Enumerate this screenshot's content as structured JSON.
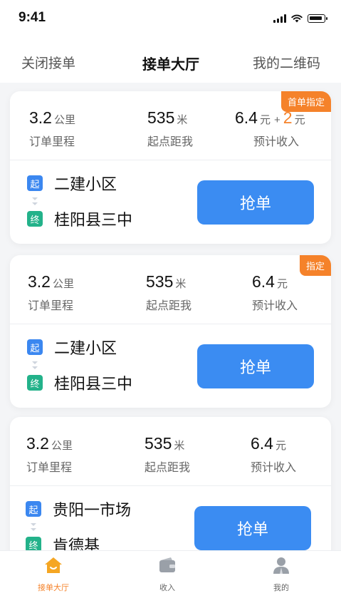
{
  "status": {
    "time": "9:41"
  },
  "topnav": {
    "left": "关闭接单",
    "center": "接单大厅",
    "right": "我的二维码"
  },
  "orders": [
    {
      "tag": "首单指定",
      "distance": {
        "value": "3.2",
        "unit": "公里",
        "label": "订单里程"
      },
      "to_start": {
        "value": "535",
        "unit": "米",
        "label": "起点距我"
      },
      "income": {
        "value": "6.4",
        "unit": "元",
        "plus": "+",
        "bonus": "2",
        "bonus_unit": "元",
        "label": "预计收入"
      },
      "start_badge": "起",
      "end_badge": "终",
      "start": "二建小区",
      "end": "桂阳县三中",
      "button": "抢单"
    },
    {
      "tag": "指定",
      "distance": {
        "value": "3.2",
        "unit": "公里",
        "label": "订单里程"
      },
      "to_start": {
        "value": "535",
        "unit": "米",
        "label": "起点距我"
      },
      "income": {
        "value": "6.4",
        "unit": "元",
        "label": "预计收入"
      },
      "start_badge": "起",
      "end_badge": "终",
      "start": "二建小区",
      "end": "桂阳县三中",
      "button": "抢单"
    },
    {
      "distance": {
        "value": "3.2",
        "unit": "公里",
        "label": "订单里程"
      },
      "to_start": {
        "value": "535",
        "unit": "米",
        "label": "起点距我"
      },
      "income": {
        "value": "6.4",
        "unit": "元",
        "label": "预计收入"
      },
      "start_badge": "起",
      "end_badge": "终",
      "start": "贵阳一市场",
      "end": "肯德基",
      "button": "抢单"
    }
  ],
  "tabbar": [
    {
      "label": "接单大厅",
      "icon": "home-icon"
    },
    {
      "label": "收入",
      "icon": "wallet-icon"
    },
    {
      "label": "我的",
      "icon": "user-icon"
    }
  ],
  "colors": {
    "accent": "#3b8cf2",
    "orange": "#f5822a",
    "green": "#23b28a"
  }
}
